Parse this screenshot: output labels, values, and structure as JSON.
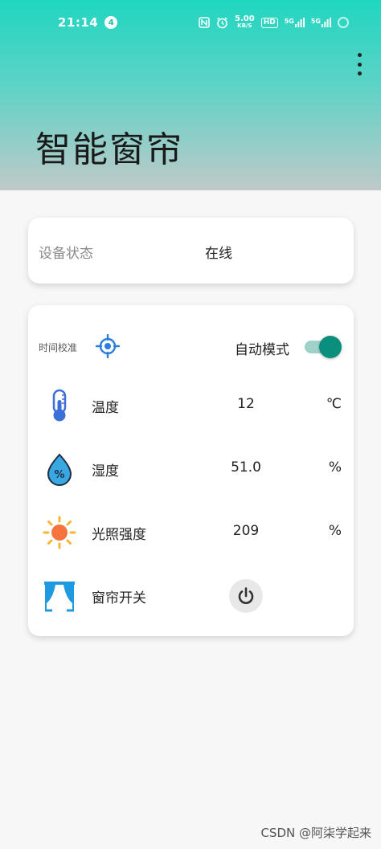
{
  "status_bar": {
    "time": "21:14",
    "notification_count": "4",
    "net_speed": "5.00",
    "net_speed_unit": "KB/S",
    "hd_badge": "HD",
    "signal_1": "5G",
    "signal_2": "5G"
  },
  "header": {
    "title": "智能窗帘",
    "menu_icon": "more-vert-icon",
    "gradient_colors": [
      "#1fd6c0",
      "#5ed3c7",
      "#bfc9c8"
    ]
  },
  "device_status": {
    "label": "设备状态",
    "value": "在线"
  },
  "controls": {
    "time_sync_label": "时间校准",
    "time_sync_icon": "crosshair-target-icon",
    "auto_mode_label": "自动模式",
    "auto_mode_on": true,
    "accent_color": "#0a8f7c"
  },
  "sensors": [
    {
      "icon": "thermometer-icon",
      "label": "温度",
      "value": "12",
      "unit": "℃"
    },
    {
      "icon": "humidity-drop-icon",
      "label": "湿度",
      "value": "51.0",
      "unit": "%"
    },
    {
      "icon": "sun-icon",
      "label": "光照强度",
      "value": "209",
      "unit": "%"
    }
  ],
  "curtain": {
    "icon": "curtain-icon",
    "label": "窗帘开关",
    "button_icon": "power-icon"
  },
  "watermark": "CSDN @阿柒学起来"
}
